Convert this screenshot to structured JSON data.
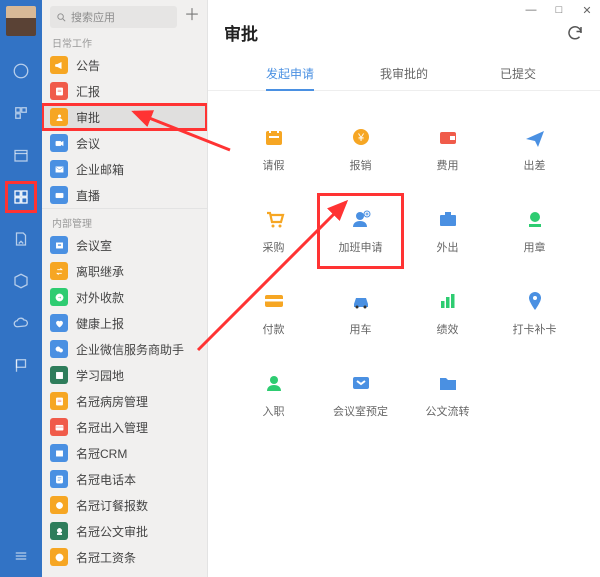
{
  "window": {
    "min": "—",
    "max": "□",
    "close": "✕"
  },
  "search": {
    "placeholder": "搜索应用"
  },
  "addBtn": "＋",
  "rail": [
    {
      "name": "chat-icon"
    },
    {
      "name": "contacts-icon"
    },
    {
      "name": "calendar-icon"
    },
    {
      "name": "apps-icon",
      "active": true
    },
    {
      "name": "docs-icon"
    },
    {
      "name": "box-icon"
    },
    {
      "name": "cloud-icon"
    },
    {
      "name": "flag-icon"
    }
  ],
  "sections": [
    {
      "title": "日常工作",
      "items": [
        {
          "label": "公告",
          "color": "#f6a623",
          "type": "horn"
        },
        {
          "label": "汇报",
          "color": "#f05b4a",
          "type": "doc"
        },
        {
          "label": "审批",
          "color": "#f6a623",
          "type": "person",
          "selected": true
        },
        {
          "label": "会议",
          "color": "#4a90e2",
          "type": "video"
        },
        {
          "label": "企业邮箱",
          "color": "#4a90e2",
          "type": "mail"
        },
        {
          "label": "直播",
          "color": "#4a90e2",
          "type": "live"
        }
      ]
    },
    {
      "title": "内部管理",
      "items": [
        {
          "label": "会议室",
          "color": "#4a90e2",
          "type": "room"
        },
        {
          "label": "离职继承",
          "color": "#f6a623",
          "type": "swap"
        },
        {
          "label": "对外收款",
          "color": "#2ecc71",
          "type": "arrow"
        },
        {
          "label": "健康上报",
          "color": "#4a90e2",
          "type": "heart"
        },
        {
          "label": "企业微信服务商助手",
          "color": "#4a90e2",
          "type": "wx"
        },
        {
          "label": "学习园地",
          "color": "#2e7d5b",
          "type": "book"
        },
        {
          "label": "名冠病房管理",
          "color": "#f6a623",
          "type": "doc"
        },
        {
          "label": "名冠出入管理",
          "color": "#f05b4a",
          "type": "card"
        },
        {
          "label": "名冠CRM",
          "color": "#4a90e2",
          "type": "crm"
        },
        {
          "label": "名冠电话本",
          "color": "#4a90e2",
          "type": "phone"
        },
        {
          "label": "名冠订餐报数",
          "color": "#f6a623",
          "type": "meal"
        },
        {
          "label": "名冠公文审批",
          "color": "#2e7d5b",
          "type": "stamp"
        },
        {
          "label": "名冠工资条",
          "color": "#f6a623",
          "type": "money"
        }
      ]
    }
  ],
  "main": {
    "title": "审批",
    "tabs": [
      {
        "label": "发起申请",
        "active": true
      },
      {
        "label": "我审批的"
      },
      {
        "label": "已提交"
      }
    ],
    "apps": [
      {
        "label": "请假",
        "color": "#f6a623",
        "shape": "calendar"
      },
      {
        "label": "报销",
        "color": "#f6a623",
        "shape": "coin"
      },
      {
        "label": "费用",
        "color": "#f05b4a",
        "shape": "wallet"
      },
      {
        "label": "出差",
        "color": "#4a90e2",
        "shape": "plane"
      },
      {
        "label": "采购",
        "color": "#f6a623",
        "shape": "cart"
      },
      {
        "label": "加班申请",
        "color": "#4a90e2",
        "shape": "userplus",
        "highlight": true
      },
      {
        "label": "外出",
        "color": "#4a90e2",
        "shape": "briefcase"
      },
      {
        "label": "用章",
        "color": "#2ecc71",
        "shape": "stamp"
      },
      {
        "label": "付款",
        "color": "#f6a623",
        "shape": "card"
      },
      {
        "label": "用车",
        "color": "#4a90e2",
        "shape": "car"
      },
      {
        "label": "绩效",
        "color": "#2ecc71",
        "shape": "bars"
      },
      {
        "label": "打卡补卡",
        "color": "#4a90e2",
        "shape": "pin"
      },
      {
        "label": "入职",
        "color": "#2ecc71",
        "shape": "user"
      },
      {
        "label": "会议室预定",
        "color": "#4a90e2",
        "shape": "flip"
      },
      {
        "label": "公文流转",
        "color": "#4a90e2",
        "shape": "folder"
      }
    ]
  }
}
